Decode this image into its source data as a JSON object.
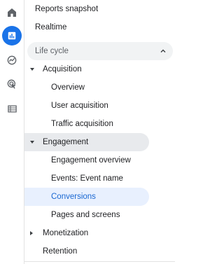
{
  "rail": {
    "icons": [
      "home-icon",
      "reports-icon",
      "explore-icon",
      "advertising-icon",
      "configure-icon"
    ],
    "active": "reports-icon",
    "accent": "#1a73e8"
  },
  "nav": {
    "reports_snapshot": "Reports snapshot",
    "realtime": "Realtime",
    "section_label": "Life cycle",
    "acquisition": {
      "label": "Acquisition",
      "items": [
        "Overview",
        "User acquisition",
        "Traffic acquisition"
      ]
    },
    "engagement": {
      "label": "Engagement",
      "items": [
        "Engagement overview",
        "Events: Event name",
        "Conversions",
        "Pages and screens"
      ]
    },
    "monetization": "Monetization",
    "retention": "Retention",
    "selected": "Conversions",
    "selected_color": "#1967d2"
  }
}
